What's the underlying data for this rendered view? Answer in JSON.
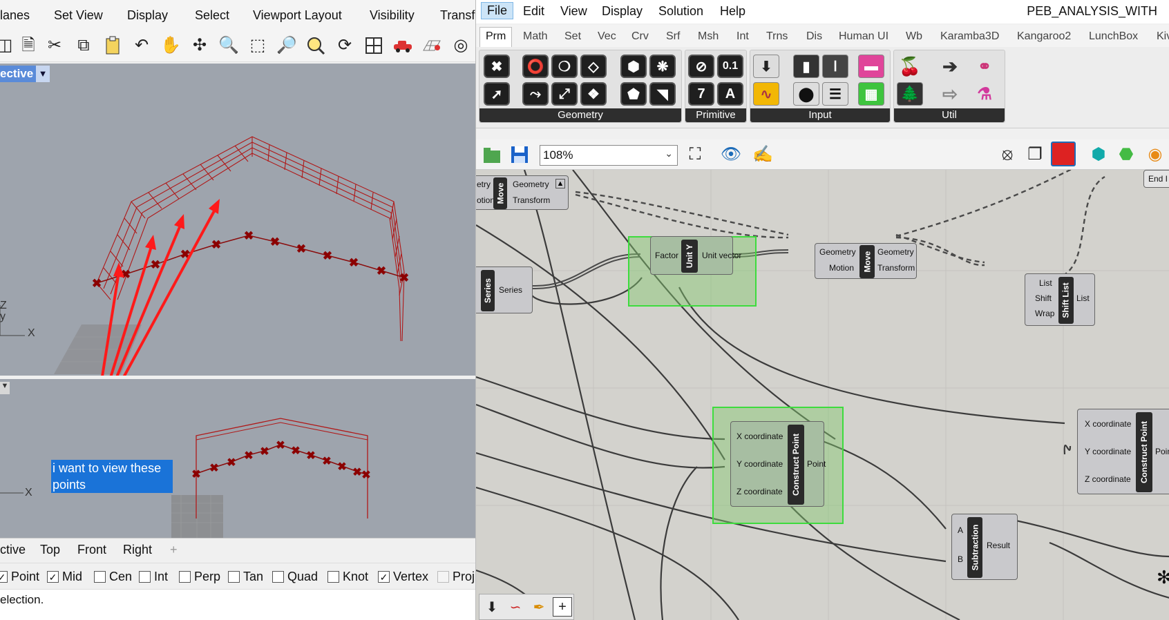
{
  "rhino": {
    "menu": [
      "lanes",
      "Set View",
      "Display",
      "Select",
      "Viewport Layout",
      "Visibility",
      "Transfo"
    ],
    "toolbar_icons": [
      "new-icon",
      "open-icon",
      "cut-icon",
      "copy-icon",
      "paste-icon",
      "undo-icon",
      "pan-icon",
      "rotate-view-icon",
      "zoom-icon",
      "zoom-window-icon",
      "zoom-extents-icon",
      "zoom-selected-icon",
      "rotate-icon",
      "four-view-icon",
      "car-icon",
      "grid-icon",
      "target-icon"
    ],
    "viewport_top": {
      "title": "ective"
    },
    "axis_labels": {
      "z": "Z",
      "y": "y",
      "x": "X",
      "x2": "X"
    },
    "annotation": "i want to view these points",
    "view_tabs": [
      "ctive",
      "Top",
      "Front",
      "Right",
      "+"
    ],
    "osnaps": [
      {
        "label": "Point",
        "checked": true
      },
      {
        "label": "Mid",
        "checked": true
      },
      {
        "label": "Cen",
        "checked": false
      },
      {
        "label": "Int",
        "checked": false
      },
      {
        "label": "Perp",
        "checked": false
      },
      {
        "label": "Tan",
        "checked": false
      },
      {
        "label": "Quad",
        "checked": false
      },
      {
        "label": "Knot",
        "checked": false
      },
      {
        "label": "Vertex",
        "checked": true
      },
      {
        "label": "Proj",
        "checked": false
      }
    ],
    "status": "election."
  },
  "gh": {
    "menu": [
      "File",
      "Edit",
      "View",
      "Display",
      "Solution",
      "Help"
    ],
    "title": "PEB_ANALYSIS_WITH",
    "tabs": [
      "Prm",
      "Math",
      "Set",
      "Vec",
      "Crv",
      "Srf",
      "Msh",
      "Int",
      "Trns",
      "Dis",
      "Human UI",
      "Wb",
      "Karamba3D",
      "Kangaroo2",
      "LunchBox",
      "Kiv"
    ],
    "ribbon_groups": [
      "Geometry",
      "Primitive",
      "Input",
      "Util"
    ],
    "primitive_icon_labels": [
      "0.1",
      "7",
      "A"
    ],
    "zoom": "108%",
    "nodes": {
      "move1": {
        "inputs": [
          "etry",
          "otion"
        ],
        "name": "Move",
        "outputs": [
          "Geometry",
          "Transform"
        ]
      },
      "series": {
        "name": "Series",
        "outputs": [
          "Series"
        ]
      },
      "unity": {
        "inputs": [
          "Factor"
        ],
        "name": "Unit Y",
        "outputs": [
          "Unit vector"
        ]
      },
      "move2": {
        "inputs": [
          "Geometry",
          "Motion"
        ],
        "name": "Move",
        "outputs": [
          "Geometry",
          "Transform"
        ]
      },
      "shift": {
        "inputs": [
          "List",
          "Shift",
          "Wrap"
        ],
        "name": "Shift List",
        "outputs": [
          "List"
        ]
      },
      "endnode": {
        "label": "End I"
      },
      "cp1": {
        "inputs": [
          "X coordinate",
          "Y coordinate",
          "Z coordinate"
        ],
        "name": "Construct Point",
        "outputs": [
          "Point"
        ]
      },
      "cp2": {
        "inputs": [
          "X coordinate",
          "Y coordinate",
          "Z coordinate"
        ],
        "name": "Construct Point",
        "outputs": [
          "Poin"
        ]
      },
      "sub": {
        "inputs": [
          "A",
          "B"
        ],
        "name": "Subtraction",
        "outputs": [
          "Result"
        ]
      }
    }
  }
}
